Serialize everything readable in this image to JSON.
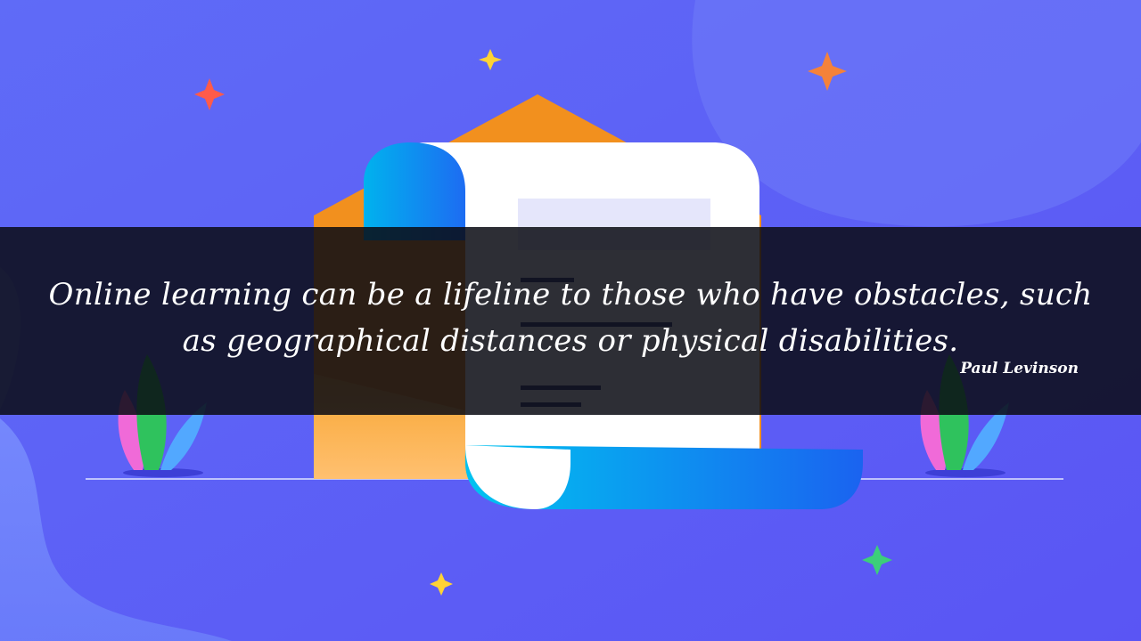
{
  "quote": {
    "text": "Online learning can be a lifeline to those who have obstacles, such as geographical distances or physical disabilities.",
    "author": "Paul Levinson"
  },
  "colors": {
    "background": "#6068f5",
    "band": "#0a0c14",
    "envelope": "#f2901e",
    "scroll_accent": "#1e9cf0",
    "paper": "#ffffff"
  },
  "icons": [
    "sparkle-icon",
    "envelope-icon",
    "scroll-icon",
    "plant-icon"
  ]
}
